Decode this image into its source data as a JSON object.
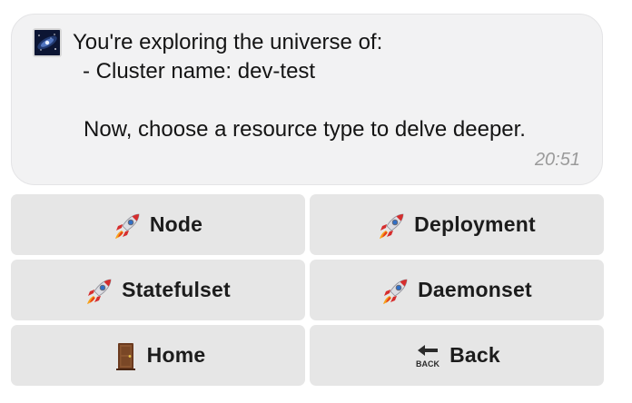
{
  "message": {
    "line1": "You're exploring the universe of:",
    "line2": "- Cluster name: dev-test",
    "line3": "Now, choose a resource type to delve deeper.",
    "time": "20:51",
    "avatar_icon": "galaxy-icon"
  },
  "keyboard": {
    "buttons": [
      {
        "label": "Node",
        "icon": "rocket-icon"
      },
      {
        "label": "Deployment",
        "icon": "rocket-icon"
      },
      {
        "label": "Statefulset",
        "icon": "rocket-icon"
      },
      {
        "label": "Daemonset",
        "icon": "rocket-icon"
      },
      {
        "label": "Home",
        "icon": "door-icon"
      },
      {
        "label": "Back",
        "icon": "back-arrow-icon",
        "icon_text": "BACK"
      }
    ]
  },
  "colors": {
    "bubble_background": "#f2f2f3",
    "button_background": "#e6e6e6",
    "timestamp": "#9a9a9a"
  }
}
